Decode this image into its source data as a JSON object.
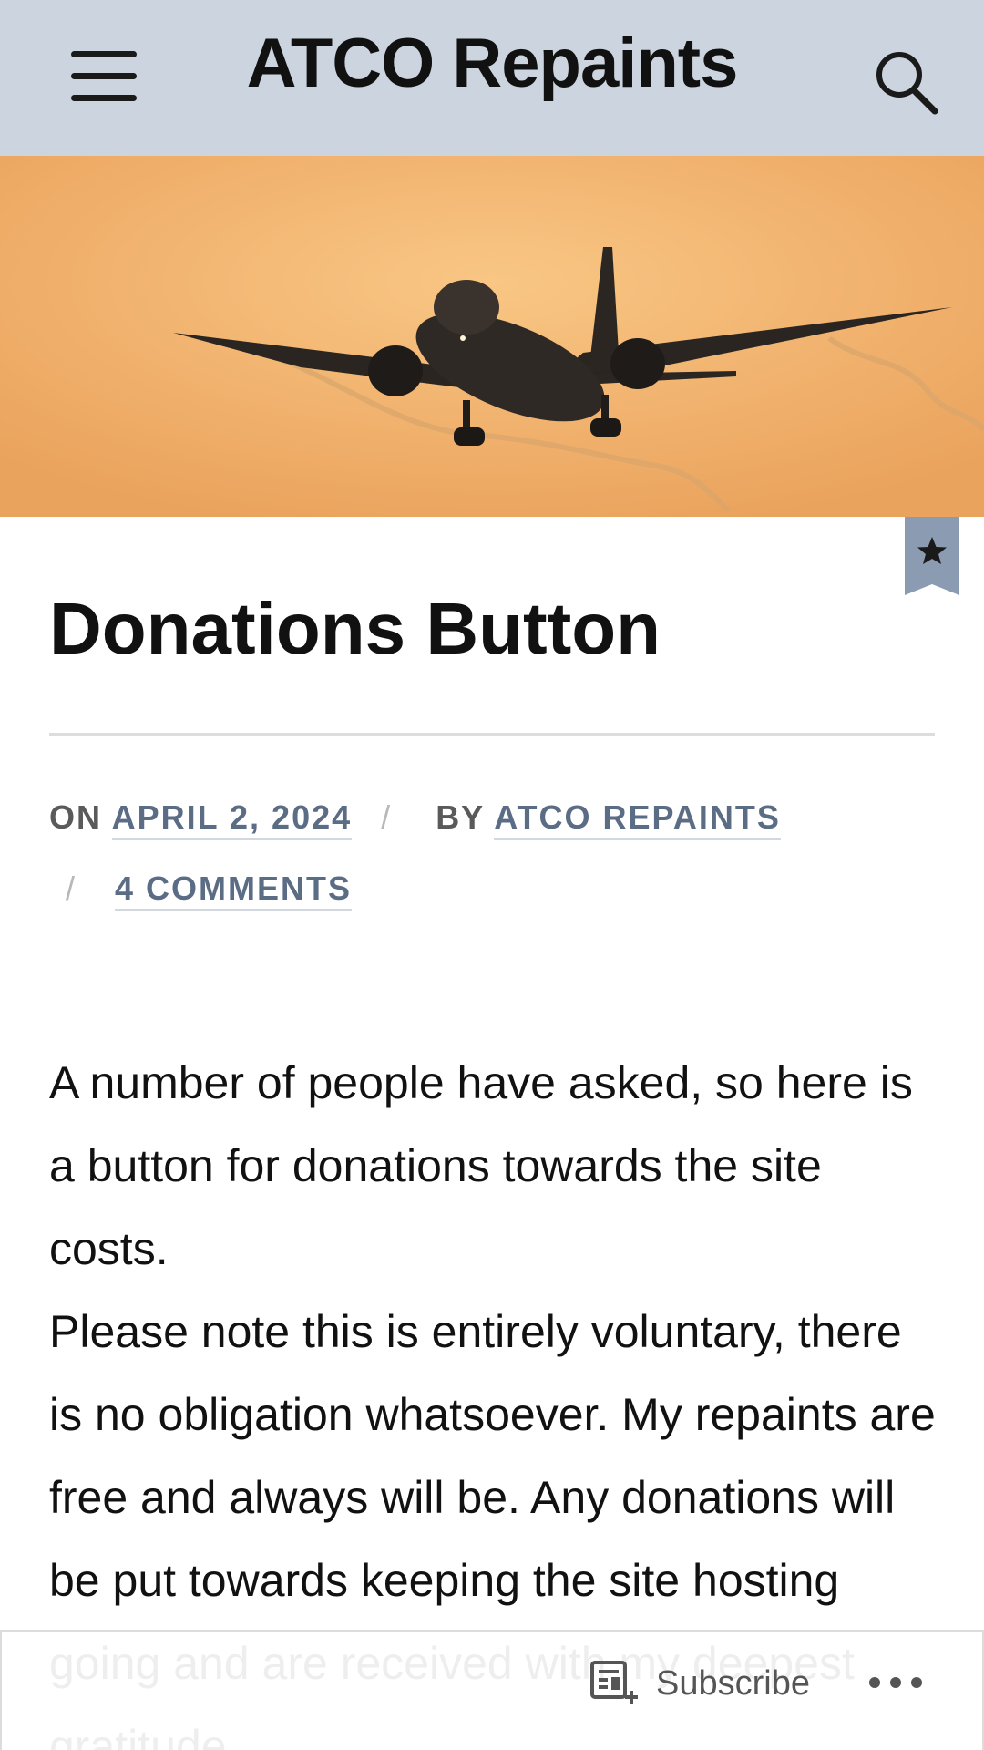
{
  "header": {
    "site_title": "ATCO Repaints",
    "menu_icon": "hamburger-menu-icon",
    "search_icon": "search-icon",
    "background": "#ccd5df"
  },
  "hero": {
    "image": "airliner-landing-sunset-photo"
  },
  "bookmark": {
    "icon": "star-icon",
    "color": "#8a9bb2"
  },
  "post": {
    "title": "Donations Button",
    "meta": {
      "on_label": "ON",
      "date": "APRIL 2, 2024",
      "separator": "/",
      "by_label": "BY",
      "author": "ATCO REPAINTS",
      "comments": "4 COMMENTS"
    },
    "paragraphs": [
      "A number of people have asked, so here is a button for donations towards the site costs.",
      "Please note this is entirely voluntary, there is no obligation whatsoever. My repaints are free and always will be. Any donations will be put towards keeping the site hosting going and are received with my deepest gratitude."
    ],
    "link_color": "#5b6c85"
  },
  "action_bar": {
    "subscribe_label": "Subscribe",
    "subscribe_icon": "subscribe-reader-icon",
    "more_icon": "more-options-icon"
  }
}
